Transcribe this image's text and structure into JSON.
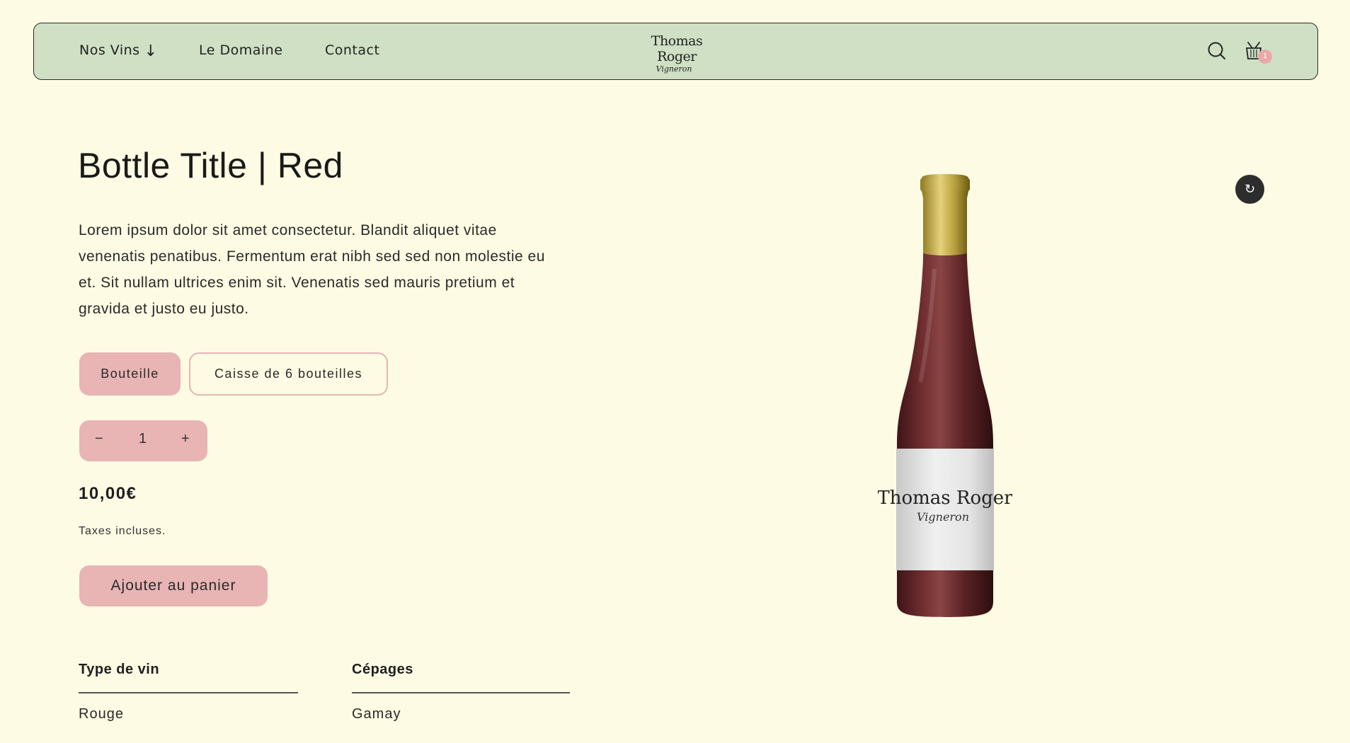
{
  "header": {
    "nav": [
      {
        "label": "Nos Vins",
        "arrow": "↓"
      },
      {
        "label": "Le Domaine"
      },
      {
        "label": "Contact"
      }
    ],
    "logo": {
      "line1": "Thomas Roger",
      "line2": "Vigneron"
    },
    "cart_count": "1"
  },
  "product": {
    "title": "Bottle Title | Red",
    "description": "Lorem ipsum dolor sit amet consectetur. Blandit aliquet vitae venenatis penatibus. Fermentum erat nibh sed sed non molestie eu et. Sit nullam ultrices enim sit. Venenatis sed mauris pretium et gravida et justo eu justo.",
    "variants": [
      {
        "label": "Bouteille",
        "selected": true
      },
      {
        "label": "Caisse de 6 bouteilles",
        "selected": false
      }
    ],
    "quantity": {
      "minus": "−",
      "value": "1",
      "plus": "+"
    },
    "price": "10,00€",
    "tax_note": "Taxes incluses.",
    "add_to_cart": "Ajouter au panier",
    "specs": [
      {
        "label": "Type de vin",
        "value": "Rouge"
      },
      {
        "label": "Cépages",
        "value": "Gamay"
      }
    ],
    "bottle_label": {
      "line1": "Thomas Roger",
      "line2": "Vigneron"
    },
    "rotate_icon": "↻"
  },
  "colors": {
    "background": "#fdfbe3",
    "header": "#cfe0c4",
    "accent_pink": "#e8b4b4",
    "wine": "#5e2426",
    "capsule_gold": "#b9a03a"
  }
}
